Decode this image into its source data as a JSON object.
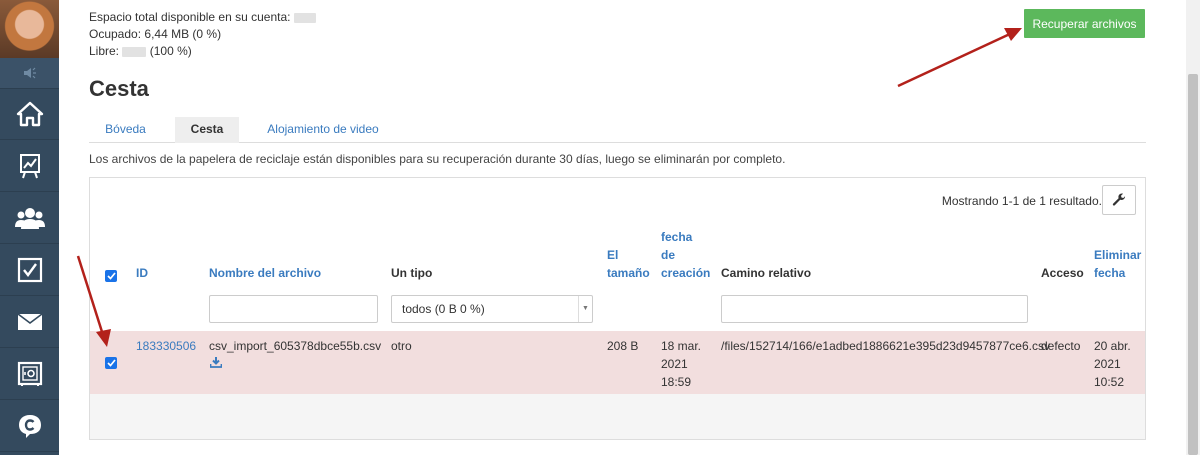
{
  "sidebar": {
    "items": [
      {
        "name": "home",
        "icon": "home-icon"
      },
      {
        "name": "statistics",
        "icon": "chart-board-icon"
      },
      {
        "name": "users",
        "icon": "users-icon"
      },
      {
        "name": "tasks",
        "icon": "checkbox-icon"
      },
      {
        "name": "mail",
        "icon": "envelope-icon"
      },
      {
        "name": "safe",
        "icon": "safe-icon"
      },
      {
        "name": "support",
        "icon": "chat-logo-icon"
      }
    ]
  },
  "storage": {
    "total_label": "Espacio total disponible en su cuenta:",
    "used_label": "Ocupado:",
    "used_value": "6,44 MB (0 %)",
    "free_label": "Libre:",
    "free_value": "(100 %)"
  },
  "recover_button": "Recuperar archivos",
  "page_title": "Cesta",
  "tabs": [
    {
      "label": "Bóveda",
      "active": false
    },
    {
      "label": "Cesta",
      "active": true
    },
    {
      "label": "Alojamiento de video",
      "active": false
    }
  ],
  "info_text": "Los archivos de la papelera de reciclaje están disponibles para su recuperación durante 30 días, luego se eliminarán por completo.",
  "table": {
    "showing": "Mostrando 1-1 de 1 resultado.",
    "headers": {
      "id": "ID",
      "name": "Nombre del archivo",
      "type": "Un tipo",
      "size": [
        "El",
        "tamaño"
      ],
      "created": [
        "fecha",
        "de",
        "creación"
      ],
      "path": "Camino relativo",
      "access": "Acceso",
      "delete": [
        "Eliminar",
        "fecha"
      ]
    },
    "filters": {
      "type_select_value": "todos (0 B 0 %)"
    },
    "rows": [
      {
        "checked": true,
        "id": "183330506",
        "name": "csv_import_605378dbce55b.csv",
        "type": "otro",
        "size": "208 B",
        "created": [
          "18 mar.",
          "2021",
          "18:59"
        ],
        "path": "/files/152714/166/e1adbed1886621e395d23d9457877ce6.csv",
        "access": "defecto",
        "deleted": [
          "20 abr.",
          "2021",
          "10:52"
        ]
      }
    ]
  },
  "colors": {
    "sidebar": "#344a5e",
    "accent_green": "#5cb85c",
    "link_blue": "#3a7bbf",
    "row_highlight": "#f2dede",
    "annotation_red": "#b3211b"
  }
}
